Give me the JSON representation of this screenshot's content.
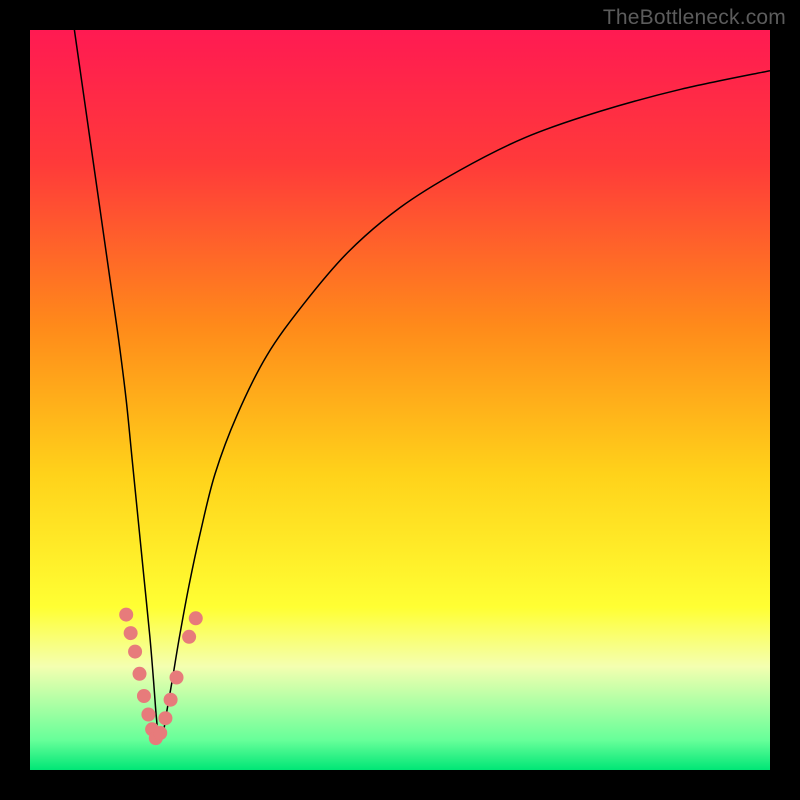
{
  "watermark": "TheBottleneck.com",
  "chart_data": {
    "type": "line",
    "title": "",
    "xlabel": "",
    "ylabel": "",
    "xlim": [
      0,
      100
    ],
    "ylim": [
      0,
      100
    ],
    "grid": false,
    "legend": false,
    "background_gradient": {
      "stops": [
        {
          "pos": 0.0,
          "color": "#ff1a52"
        },
        {
          "pos": 0.18,
          "color": "#ff3a3a"
        },
        {
          "pos": 0.4,
          "color": "#ff8a1a"
        },
        {
          "pos": 0.6,
          "color": "#ffd21a"
        },
        {
          "pos": 0.78,
          "color": "#ffff33"
        },
        {
          "pos": 0.86,
          "color": "#f4ffb0"
        },
        {
          "pos": 0.96,
          "color": "#66ff99"
        },
        {
          "pos": 1.0,
          "color": "#00e676"
        }
      ]
    },
    "series": [
      {
        "name": "bottleneck-curve",
        "color": "#000000",
        "width": 1.5,
        "x": [
          6,
          7,
          8,
          9,
          10,
          11,
          12,
          13,
          13.8,
          14.6,
          15.4,
          16.2,
          16.7,
          17.0,
          17.3,
          17.6,
          18.0,
          18.5,
          19.2,
          20.2,
          21.5,
          23,
          25,
          28,
          32,
          37,
          43,
          50,
          58,
          67,
          77,
          88,
          100
        ],
        "y": [
          100,
          93,
          86,
          79,
          72,
          65,
          58,
          50,
          42,
          34,
          26,
          18,
          12,
          8,
          5,
          4,
          5,
          8,
          12,
          18,
          25,
          32,
          40,
          48,
          56,
          63,
          70,
          76,
          81,
          85.5,
          89,
          92,
          94.5
        ]
      }
    ],
    "markers": {
      "name": "highlight-dots",
      "color": "#e77b7b",
      "radius": 7,
      "points": [
        {
          "x": 13.0,
          "y": 21.0
        },
        {
          "x": 13.6,
          "y": 18.5
        },
        {
          "x": 14.2,
          "y": 16.0
        },
        {
          "x": 14.8,
          "y": 13.0
        },
        {
          "x": 15.4,
          "y": 10.0
        },
        {
          "x": 16.0,
          "y": 7.5
        },
        {
          "x": 16.5,
          "y": 5.5
        },
        {
          "x": 17.0,
          "y": 4.3
        },
        {
          "x": 17.6,
          "y": 5.0
        },
        {
          "x": 18.3,
          "y": 7.0
        },
        {
          "x": 19.0,
          "y": 9.5
        },
        {
          "x": 19.8,
          "y": 12.5
        },
        {
          "x": 21.5,
          "y": 18.0
        },
        {
          "x": 22.4,
          "y": 20.5
        }
      ]
    }
  }
}
